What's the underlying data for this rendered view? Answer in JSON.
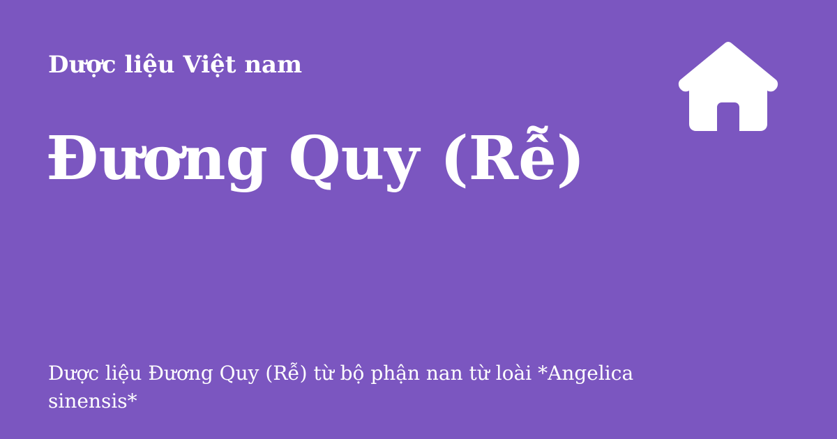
{
  "site": {
    "name": "Dược liệu Việt nam"
  },
  "page": {
    "title": "Đương Quy (Rễ)",
    "description": "Dược liệu Đương Quy (Rễ) từ bộ phận nan từ loài *Angelica sinensis*"
  },
  "icons": {
    "home": "home-icon"
  },
  "colors": {
    "background": "#7b56c0",
    "text": "#ffffff"
  }
}
